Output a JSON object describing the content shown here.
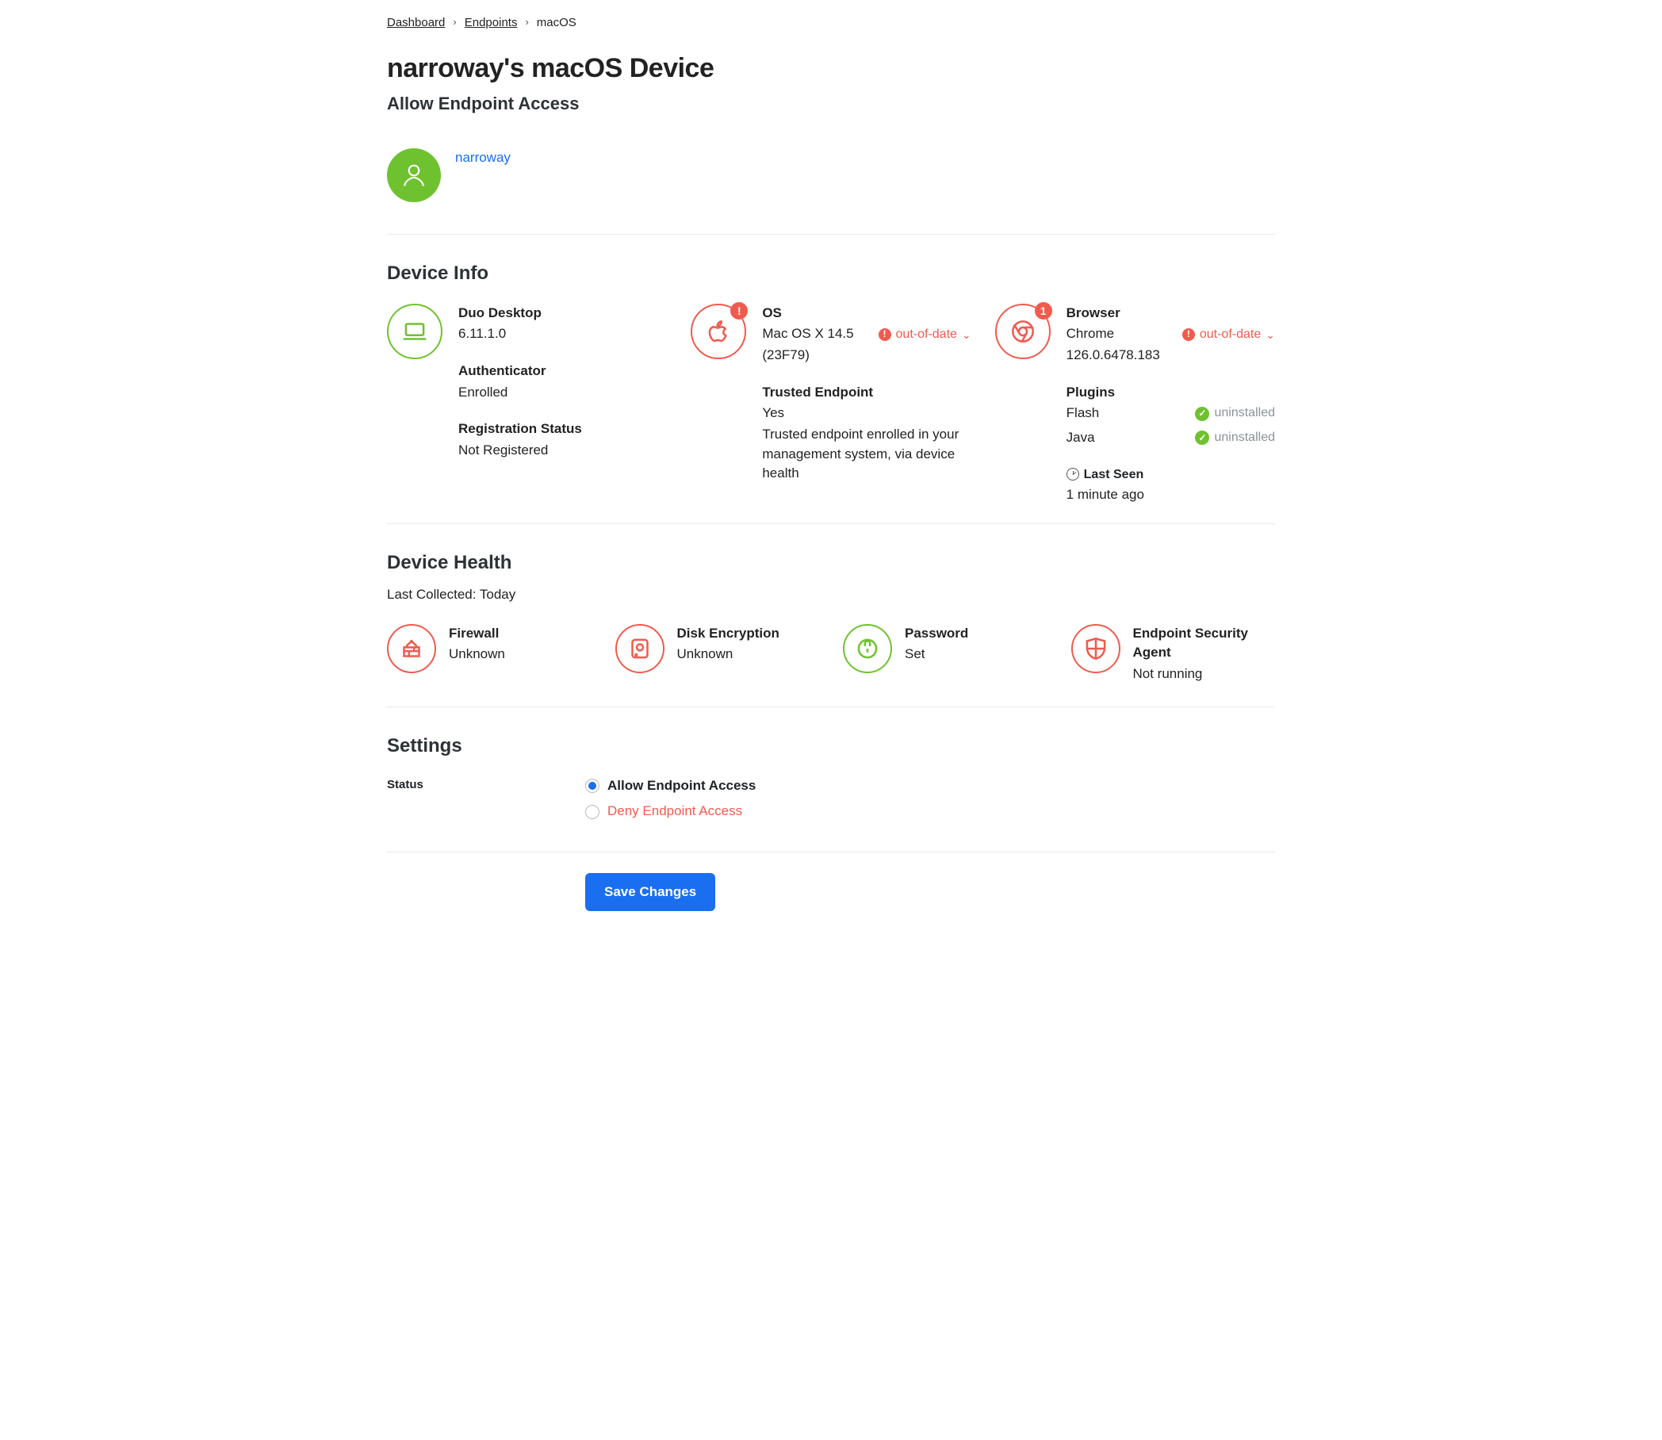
{
  "breadcrumb": {
    "a": "Dashboard",
    "b": "Endpoints",
    "c": "macOS"
  },
  "title": "narroway's macOS Device",
  "subtitle": "Allow Endpoint Access",
  "owner": {
    "name": "narroway"
  },
  "device_info": {
    "heading": "Device Info",
    "col1": {
      "app_label": "Duo Desktop",
      "app_version": "6.11.1.0",
      "auth_label": "Authenticator",
      "auth_value": "Enrolled",
      "reg_label": "Registration Status",
      "reg_value": "Not Registered"
    },
    "col2": {
      "os_label": "OS",
      "os_line1": "Mac OS X 14.5",
      "os_line2": "(23F79)",
      "os_status": "out-of-date",
      "te_label": "Trusted Endpoint",
      "te_value": "Yes",
      "te_desc": "Trusted endpoint enrolled in your management system, via device health"
    },
    "col3": {
      "browser_label": "Browser",
      "browser_name": "Chrome",
      "browser_version": "126.0.6478.183",
      "browser_status": "out-of-date",
      "browser_badge": "1",
      "plugins_label": "Plugins",
      "plugin1_name": "Flash",
      "plugin1_status": "uninstalled",
      "plugin2_name": "Java",
      "plugin2_status": "uninstalled",
      "seen_label": "Last Seen",
      "seen_value": "1 minute ago"
    }
  },
  "device_health": {
    "heading": "Device Health",
    "collected": "Last Collected: Today",
    "items": [
      {
        "label": "Firewall",
        "value": "Unknown"
      },
      {
        "label": "Disk Encryption",
        "value": "Unknown"
      },
      {
        "label": "Password",
        "value": "Set"
      },
      {
        "label": "Endpoint Security Agent",
        "value": "Not running"
      }
    ]
  },
  "settings": {
    "heading": "Settings",
    "status_label": "Status",
    "allow": "Allow Endpoint Access",
    "deny": "Deny Endpoint Access",
    "save": "Save Changes"
  }
}
